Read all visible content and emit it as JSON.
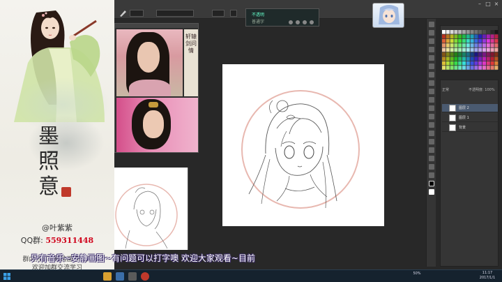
{
  "promo": {
    "brand": "墨 照 意",
    "author": "@叶紫紫",
    "qq_label": "QQ群:",
    "qq_number": "559311448",
    "message_line1": "群内分享笔刷绘画等资料",
    "message_line2": "欢迎加群交流学习"
  },
  "photoshop": {
    "popup_line1": "不透明",
    "popup_line2": "普通字",
    "reference_caption": "轩辕剑问情",
    "layers_header": "正常",
    "layers_opacity": "不透明度: 100%",
    "layers": [
      {
        "name": "图层 2"
      },
      {
        "name": "图层 1"
      },
      {
        "name": "背景"
      }
    ]
  },
  "subtitle": "只有音乐~安静画图~有问题可以打字噢 欢迎大家观看~目前",
  "taskbar": {
    "tray_text": "50%",
    "time": "11:17",
    "date": "2017/1/1"
  },
  "colors": {
    "canvas_circle": "#e8b8b0",
    "panel_bg": "#353535",
    "qq_number": "#d0021b"
  }
}
